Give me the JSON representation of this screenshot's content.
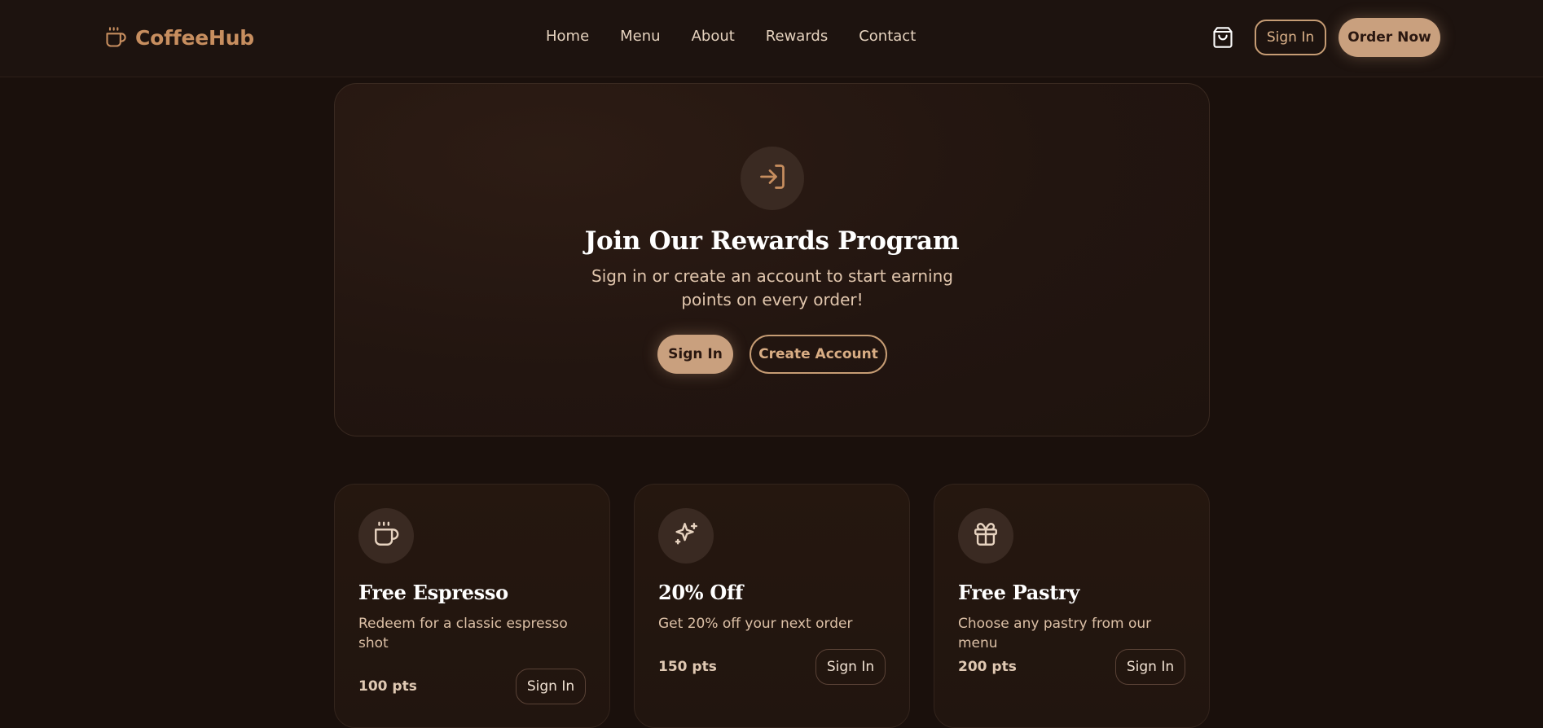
{
  "brand": {
    "name": "CoffeeHub",
    "icon": "coffee-cup-icon",
    "color": "#c78e5f"
  },
  "nav": {
    "links": [
      "Home",
      "Menu",
      "About",
      "Rewards",
      "Contact"
    ],
    "cart_icon": "shopping-bag-icon",
    "sign_in": "Sign In",
    "order_now": "Order Now"
  },
  "hero": {
    "icon": "sign-in-arrow-icon",
    "title": "Join Our Rewards Program",
    "subtitle": "Sign in or create an account to start earning points on every order!",
    "primary_button": "Sign In",
    "secondary_button": "Create Account"
  },
  "rewards": [
    {
      "icon": "coffee-cup-icon",
      "title": "Free Espresso",
      "description": "Redeem for a classic espresso shot",
      "points": "100 pts",
      "button": "Sign In"
    },
    {
      "icon": "sparkles-icon",
      "title": "20% Off",
      "description": "Get 20% off your next order",
      "points": "150 pts",
      "button": "Sign In"
    },
    {
      "icon": "gift-icon",
      "title": "Free Pastry",
      "description": "Choose any pastry from our menu",
      "points": "200 pts",
      "button": "Sign In"
    }
  ],
  "colors": {
    "accent": "#c9a07e",
    "background": "#1a100c",
    "card": "#23160f"
  }
}
